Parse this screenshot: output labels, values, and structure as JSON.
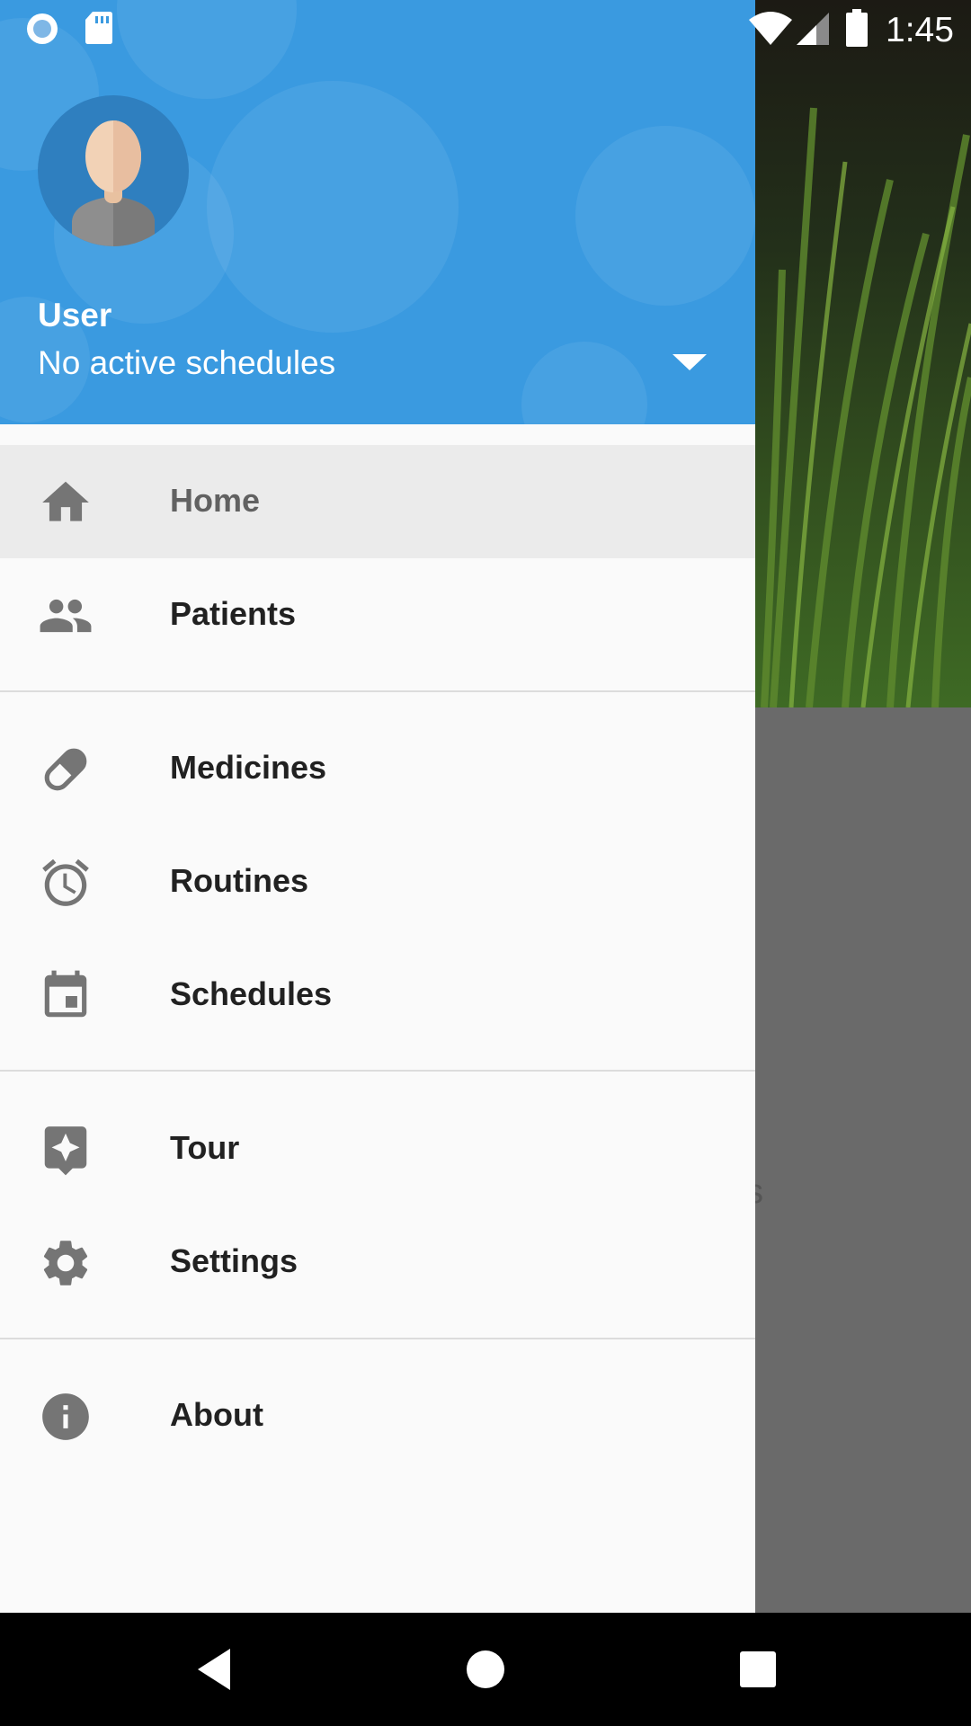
{
  "status_bar": {
    "time": "1:45"
  },
  "drawer_header": {
    "user_name": "User",
    "user_subtitle": "No active schedules"
  },
  "menu": {
    "items": [
      {
        "label": "Home",
        "icon": "home-icon",
        "active": true
      },
      {
        "label": "Patients",
        "icon": "people-icon"
      },
      {
        "label": "Medicines",
        "icon": "pill-icon"
      },
      {
        "label": "Routines",
        "icon": "alarm-clock-icon"
      },
      {
        "label": "Schedules",
        "icon": "calendar-icon"
      },
      {
        "label": "Tour",
        "icon": "sparkle-icon"
      },
      {
        "label": "Settings",
        "icon": "gear-icon"
      },
      {
        "label": "About",
        "icon": "info-icon"
      }
    ]
  },
  "colors": {
    "header_blue": "#3a9ae0",
    "drawer_bg": "#fafafa",
    "active_item_bg": "#ebebeb",
    "icon_grey": "#757575"
  }
}
